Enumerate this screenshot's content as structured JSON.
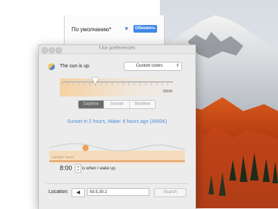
{
  "sysprefs": {
    "select_value": "По умолчанию*",
    "refresh_button": "Обновить"
  },
  "window": {
    "title": "f.lux preferences",
    "status": "The sun is up.",
    "color_mode": "Custom colors",
    "slider": {
      "kelvin_label": "3900K",
      "level": 0.3
    },
    "segments": [
      "Daytime",
      "Sunset",
      "Bedtime"
    ],
    "selected_segment": "Daytime",
    "info": "Sunset in 2 hours, Wake: 6 hours ago (3900K)",
    "graph": {
      "label": "sunlight hours"
    },
    "wake": {
      "time": "8:00",
      "label": "is when I wake up."
    },
    "location": {
      "label": "Location:",
      "value": "59.5,30.2",
      "search_button": "Search"
    }
  },
  "colors": {
    "accent_blue": "#3f86e8",
    "info_blue": "#4a8bd8",
    "graph_orange": "#f0a155"
  }
}
